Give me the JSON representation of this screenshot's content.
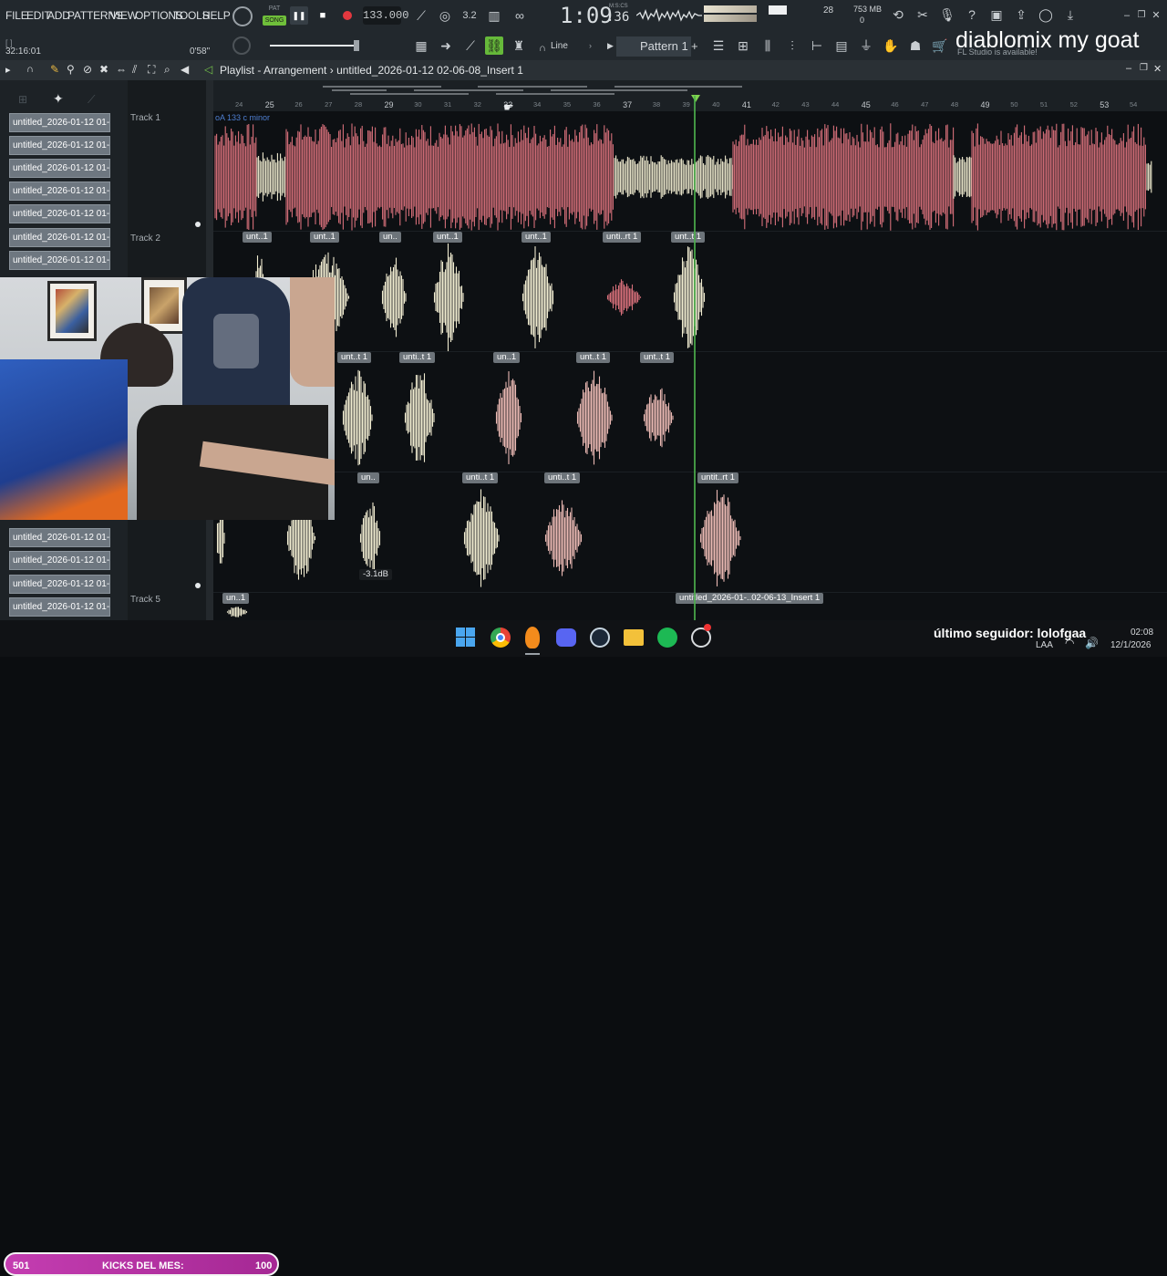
{
  "menu": [
    "FILE",
    "EDIT",
    "ADD",
    "PATTERNS",
    "VIEW",
    "OPTIONS",
    "TOOLS",
    "HELP"
  ],
  "transport": {
    "mode_pat": "PAT",
    "mode_song": "SONG",
    "tempo": "133.000"
  },
  "time_display": {
    "main": "1:09",
    "sub": ":36",
    "label": "M:S:CS"
  },
  "cpu": {
    "voices": "28",
    "memory": "753 MB",
    "mem_sub": "0"
  },
  "hint": {
    "left": "32:16:01",
    "right": "0'58\""
  },
  "snap": {
    "label": "Line"
  },
  "pattern": {
    "label": "Pattern 1"
  },
  "overlay": {
    "title": "diablomix my goat",
    "subtitle": "FL Studio is available!"
  },
  "playlist": {
    "title": "Playlist - Arrangement",
    "crumb": "›",
    "file": "untitled_2026-01-12 02-06-08_Insert 1"
  },
  "browser_items": [
    "untitled_2026-01-12 01-...",
    "untitled_2026-01-12 01-...",
    "untitled_2026-01-12 01-...",
    "untitled_2026-01-12 01-...",
    "untitled_2026-01-12 01-...",
    "untitled_2026-01-12 01-...",
    "untitled_2026-01-12 01-..."
  ],
  "browser_items_bottom": [
    "untitled_2026-01-12 01-...",
    "untitled_2026-01-12 01-...",
    "untitled_2026-01-12 01-...",
    "untitled_2026-01-12 01-..."
  ],
  "tracks": {
    "t1": "Track 1",
    "t2": "Track 2",
    "t5": "Track 5"
  },
  "ruler_ticks": [
    "24",
    "25",
    "26",
    "27",
    "28",
    "29",
    "30",
    "31",
    "32",
    "33",
    "34",
    "35",
    "36",
    "37",
    "38",
    "39",
    "40",
    "41",
    "42",
    "43",
    "44",
    "45",
    "46",
    "47",
    "48",
    "49",
    "50",
    "51",
    "52",
    "53",
    "54"
  ],
  "track1_marker": "oA 133 c minor",
  "clips_t2": [
    "unt..1",
    "unt..1",
    "un..",
    "unt..1",
    "unt..1",
    "unti..rt 1",
    "unt..t 1"
  ],
  "clips_t3": [
    "unt..t 1",
    "unti..t 1",
    "un..1",
    "unt..t 1",
    "unt..t 1"
  ],
  "clips_t4": [
    "un..",
    "unti..t 1",
    "unti..t 1",
    "untit..rt 1"
  ],
  "clips_t5": [
    "un..1",
    "untitled_2026-01-..02-06-13_Insert 1"
  ],
  "volume_label": "-3.1dB",
  "stream": {
    "kicks_count": "501",
    "kicks_label": "KICKS DEL MES:",
    "kicks_goal": "100",
    "follower": "último seguidor: lolofgaa"
  },
  "tray": {
    "time": "02:08",
    "date": "12/1/2026",
    "lang": "LAA"
  }
}
